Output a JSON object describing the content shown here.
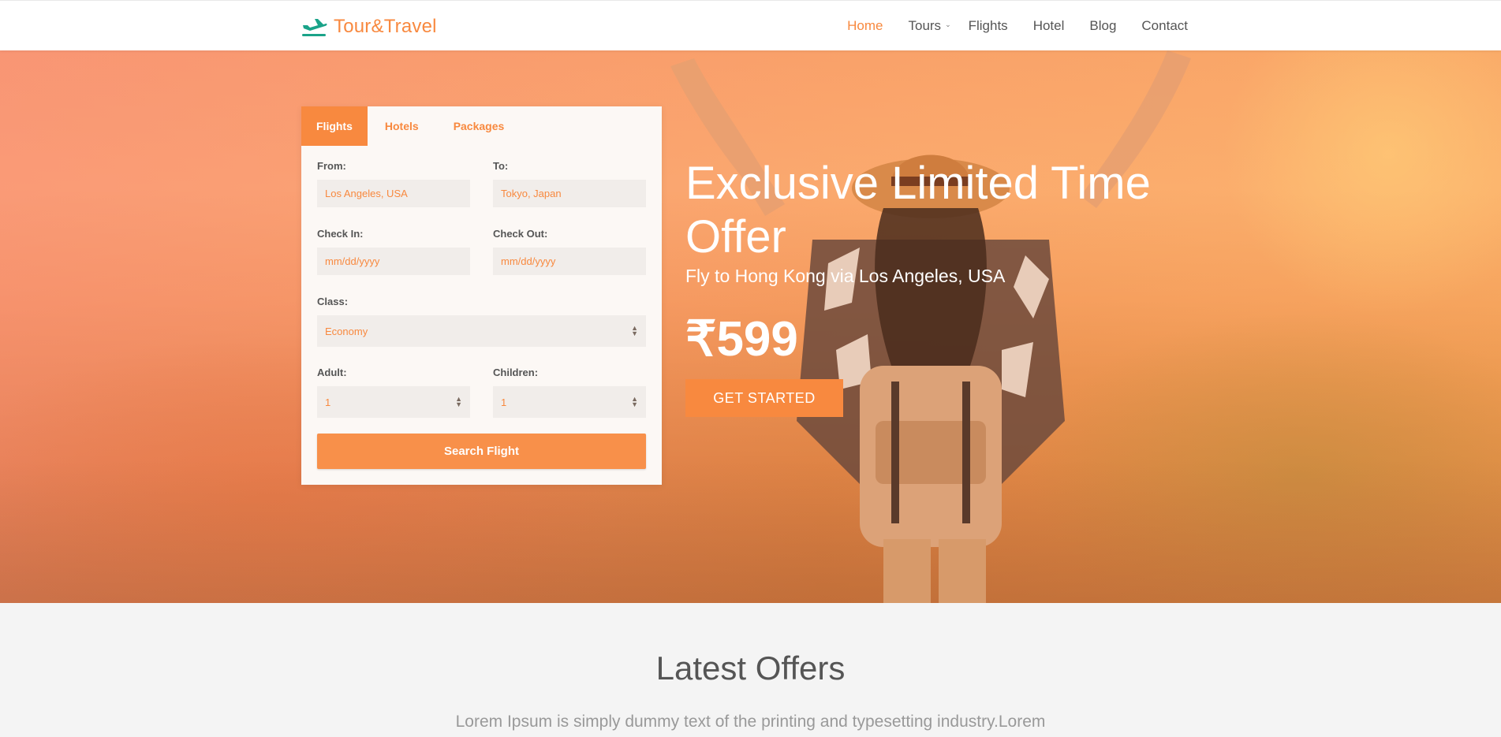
{
  "header": {
    "brand": "Tour&Travel",
    "brand_icon": "airplane-icon",
    "nav": [
      {
        "label": "Home",
        "active": true
      },
      {
        "label": "Tours",
        "has_dropdown": true
      },
      {
        "label": "Flights"
      },
      {
        "label": "Hotel"
      },
      {
        "label": "Blog"
      },
      {
        "label": "Contact"
      }
    ]
  },
  "booking": {
    "tabs": [
      "Flights",
      "Hotels",
      "Packages"
    ],
    "active_tab": "Flights",
    "from_label": "From:",
    "from_placeholder": "Los Angeles, USA",
    "to_label": "To:",
    "to_placeholder": "Tokyo, Japan",
    "checkin_label": "Check In:",
    "checkin_placeholder": "mm/dd/yyyy",
    "checkout_label": "Check Out:",
    "checkout_placeholder": "mm/dd/yyyy",
    "class_label": "Class:",
    "class_value": "Economy",
    "adult_label": "Adult:",
    "adult_value": "1",
    "children_label": "Children:",
    "children_value": "1",
    "search_label": "Search Flight"
  },
  "offer": {
    "title": "Exclusive Limited Time Offer",
    "subtitle": "Fly to Hong Kong via Los Angeles, USA",
    "price": "₹599",
    "cta": "GET STARTED"
  },
  "latest": {
    "title": "Latest Offers",
    "text": "Lorem Ipsum is simply dummy text of the printing and typesetting industry.Lorem"
  },
  "colors": {
    "accent": "#f8893f",
    "brand_icon": "#1aa389",
    "page_bg": "#f4f4f4"
  }
}
